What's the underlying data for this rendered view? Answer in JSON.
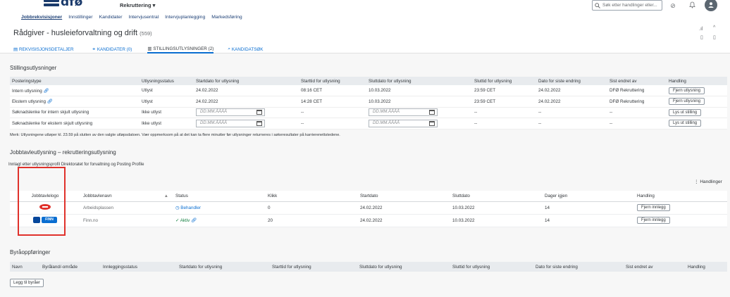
{
  "header": {
    "logo_text": "dfø",
    "app_title": "Rekruttering ▾",
    "nav": [
      "Jobbrekvisisjoner",
      "Innstillinger",
      "Kandidater",
      "Intervjusentral",
      "Intervjuplanlegging",
      "Markedsføring"
    ],
    "search_placeholder": "Søk etter handlinger eller...",
    "avatar_icon": "user-icon"
  },
  "object": {
    "title": "Rådgiver - husleieforvaltning og drift",
    "count": "(559)",
    "tabs": [
      "REKVISISJONSDETALJER",
      "KANDIDATER (0)",
      "STILLINGSUTLYSNINGER (2)",
      "KANDIDATSØK"
    ]
  },
  "postings": {
    "title": "Stillingsutlysninger",
    "headers": [
      "Posteringstype",
      "Utlysningsstatus",
      "Startdato for utlysning",
      "Starttid for utlysning",
      "Sluttdato for utlysning",
      "Sluttid for utlysning",
      "Dato for siste endring",
      "Sist endret av",
      "Handling"
    ],
    "rows": [
      {
        "type": "Intern utlysning",
        "status": "Utlyst",
        "start": "24.02.2022",
        "starttime": "08:16 CET",
        "end": "10.03.2022",
        "endtime": "23:59 CET",
        "changed": "24.02.2022",
        "by": "DFØ Rekruttering",
        "action": "Fjern utlysning"
      },
      {
        "type": "Ekstern utlysning",
        "status": "Utlyst",
        "start": "24.02.2022",
        "starttime": "14:28 CET",
        "end": "10.03.2022",
        "endtime": "23:59 CET",
        "changed": "24.02.2022",
        "by": "DFØ Rekruttering",
        "action": "Fjern utlysning"
      },
      {
        "type": "Søknadslenke for intern skjult utlysning",
        "status": "Ikke utlyst",
        "start": "DD.MM.ÅÅÅÅ",
        "starttime": "--",
        "end": "DD.MM.ÅÅÅÅ",
        "endtime": "--",
        "changed": "--",
        "by": "--",
        "action": "Lys ut stilling"
      },
      {
        "type": "Søknadslenke for ekstern skjult utlysning",
        "status": "Ikke utlyst",
        "start": "DD.MM.ÅÅÅÅ",
        "starttime": "--",
        "end": "DD.MM.ÅÅÅÅ",
        "endtime": "--",
        "changed": "--",
        "by": "--",
        "action": "Lys ut stilling"
      }
    ],
    "note": "Merk: Utlysningene utløper kl. 23.59 på slutten av den valgte utløpsdatoen. Vær oppmerksom på at det kan ta flere minutter før utlysninger returneres i søkeresultater på karrierenettstedene."
  },
  "jobboards": {
    "title": "Jobbtavleutlysning – rekrutteringsutlysning",
    "subtitle": "Innlagt etter utlysningsprofil Direktoratet for forvaltning og Posting Profile",
    "actions_label": "Handlinger",
    "headers": [
      "Jobbtavlelogo",
      "Jobbtavlenavn",
      "Status",
      "Klikk",
      "Startdato",
      "Sluttdato",
      "Dager igjen",
      "Handling"
    ],
    "rows": [
      {
        "logo": "arbeidsplassen-logo",
        "name": "Arbeidsplassen",
        "status": "Behandler",
        "clicks": "0",
        "start": "24.02.2022",
        "end": "10.03.2022",
        "days": "14",
        "action": "Fjern innlegg"
      },
      {
        "logo": "finn-logo",
        "name": "Finn.no",
        "status": "Aktiv",
        "clicks": "20",
        "start": "24.02.2022",
        "end": "10.03.2022",
        "days": "14",
        "action": "Fjern innlegg",
        "logo_text": "FINN"
      }
    ]
  },
  "agency": {
    "title": "Byråoppføringer",
    "headers": [
      "Navn",
      "Byråland/-område",
      "Innleggingsstatus",
      "Startdato for utlysning",
      "Starttid for utlysning",
      "Sluttdato for utlysning",
      "Sluttid for utlysning",
      "Dato for siste endring",
      "Sist endret av",
      "Handling"
    ],
    "add_button": "Legg til byråer"
  },
  "colors": {
    "accent": "#0a6ed1",
    "highlight": "#e0312b",
    "success": "#107e3e"
  }
}
